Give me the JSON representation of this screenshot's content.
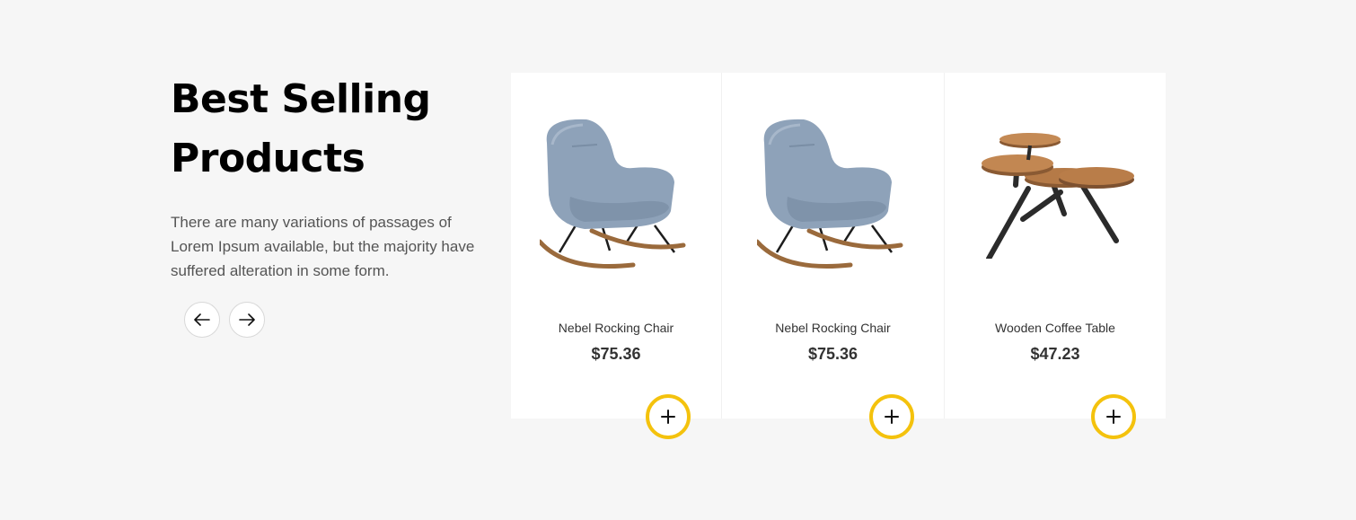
{
  "section": {
    "title": "Best Selling Products",
    "description": "There are many variations of passages of Lorem Ipsum available, but the majority have suffered alteration in some form."
  },
  "nav": {
    "prev_icon": "arrow-left-icon",
    "next_icon": "arrow-right-icon"
  },
  "products": [
    {
      "name": "Nebel Rocking Chair",
      "price": "$75.36",
      "image": "rocking-chair"
    },
    {
      "name": "Nebel Rocking Chair",
      "price": "$75.36",
      "image": "rocking-chair"
    },
    {
      "name": "Wooden Coffee Table",
      "price": "$47.23",
      "image": "coffee-table"
    }
  ],
  "colors": {
    "accent": "#f4c20d",
    "background": "#f6f6f6",
    "card": "#ffffff"
  }
}
